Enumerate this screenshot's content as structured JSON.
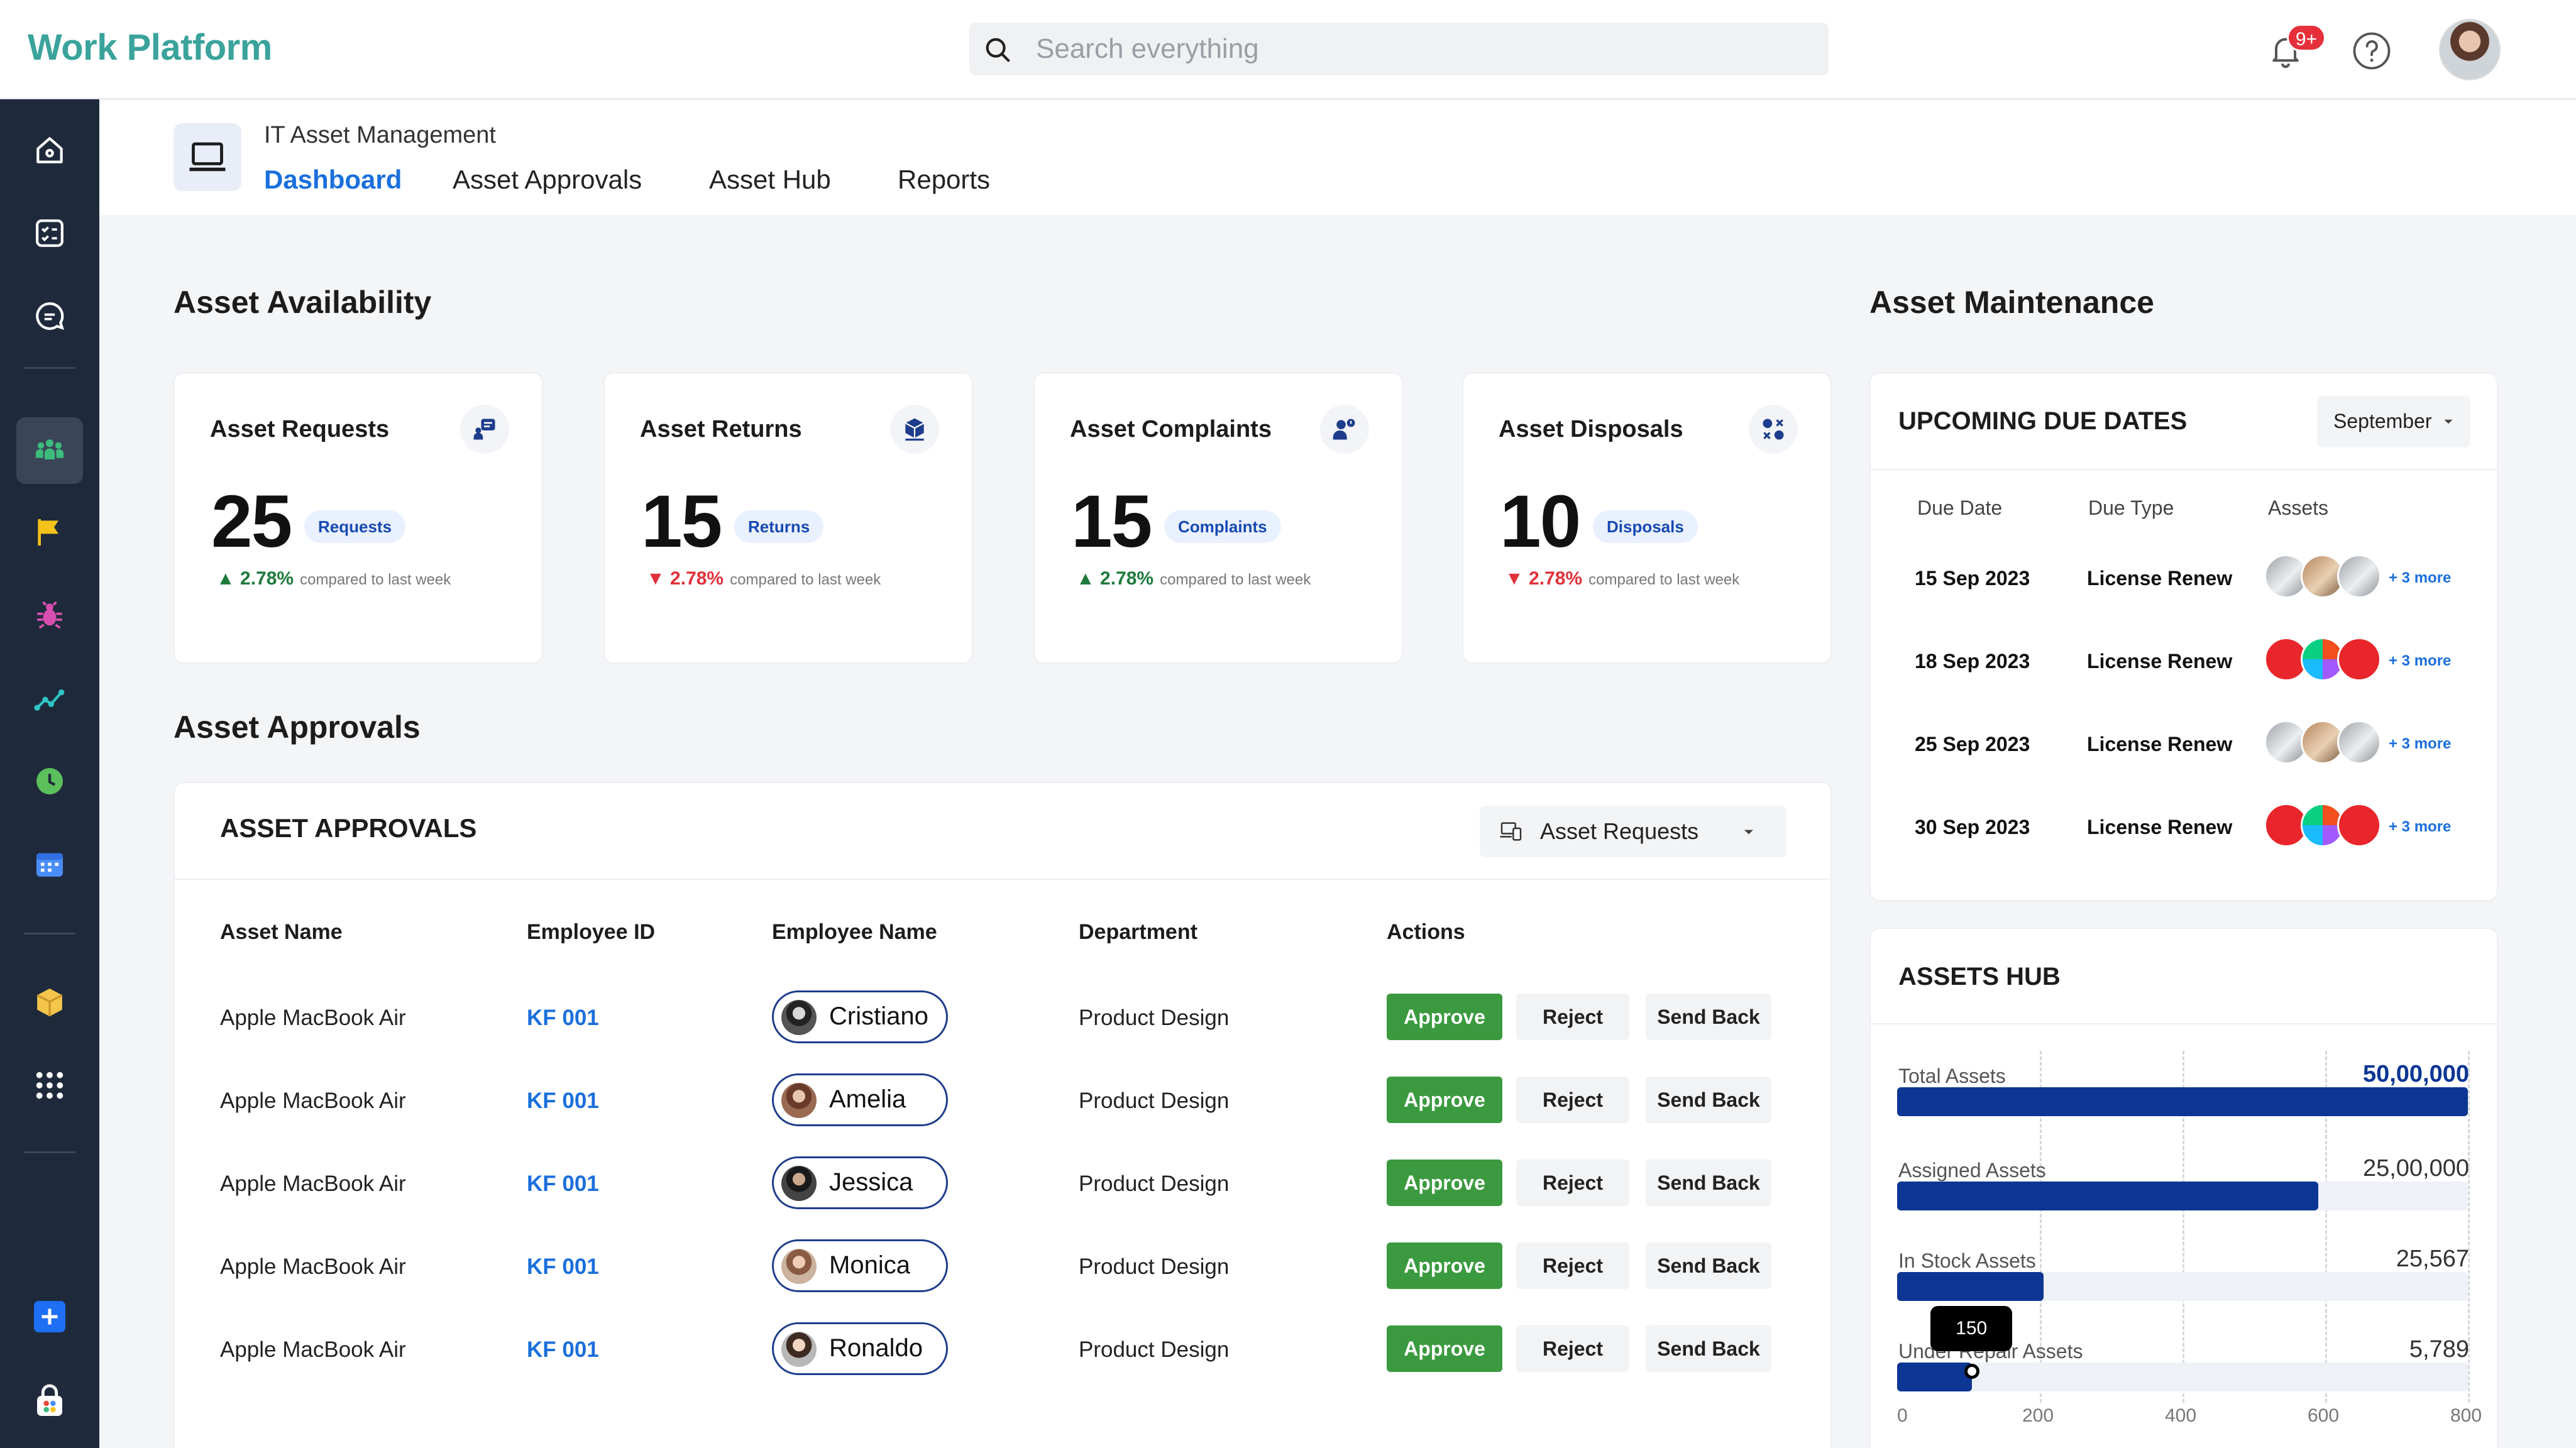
{
  "app": {
    "name": "Work Platform"
  },
  "search": {
    "placeholder": "Search everything"
  },
  "notifications": {
    "badge": "9+"
  },
  "sidebar": {
    "items": [
      "home",
      "tasks",
      "chat",
      "team",
      "flag",
      "bug",
      "analytics",
      "clock",
      "calendar",
      "package",
      "apps"
    ]
  },
  "module": {
    "title": "IT Asset Management"
  },
  "tabs": [
    {
      "label": "Dashboard",
      "active": true
    },
    {
      "label": "Asset Approvals",
      "active": false
    },
    {
      "label": "Asset Hub",
      "active": false
    },
    {
      "label": "Reports",
      "active": false
    }
  ],
  "availability": {
    "title": "Asset  Availability",
    "cards": [
      {
        "title": "Asset Requests",
        "value": "25",
        "pill": "Requests",
        "pct": "2.78%",
        "dir": "up",
        "compare": "compared to last week"
      },
      {
        "title": "Asset Returns",
        "value": "15",
        "pill": "Returns",
        "pct": "2.78%",
        "dir": "down",
        "compare": "compared to last week"
      },
      {
        "title": "Asset Complaints",
        "value": "15",
        "pill": "Complaints",
        "pct": "2.78%",
        "dir": "up",
        "compare": "compared to last week"
      },
      {
        "title": "Asset Disposals",
        "value": "10",
        "pill": "Disposals",
        "pct": "2.78%",
        "dir": "down",
        "compare": "compared to last week"
      }
    ]
  },
  "approvals": {
    "section_title": "Asset  Approvals",
    "card_title": "ASSET APPROVALS",
    "filter": "Asset Requests",
    "columns": [
      "Asset Name",
      "Employee ID",
      "Employee Name",
      "Department",
      "Actions"
    ],
    "rows": [
      {
        "asset": "Apple MacBook Air",
        "id": "KF 001",
        "name": "Cristiano",
        "dept": "Product Design"
      },
      {
        "asset": "Apple MacBook Air",
        "id": "KF 001",
        "name": "Amelia",
        "dept": "Product Design"
      },
      {
        "asset": "Apple MacBook Air",
        "id": "KF 001",
        "name": "Jessica",
        "dept": "Product Design"
      },
      {
        "asset": "Apple MacBook Air",
        "id": "KF 001",
        "name": "Monica",
        "dept": "Product Design"
      },
      {
        "asset": "Apple MacBook Air",
        "id": "KF 001",
        "name": "Ronaldo",
        "dept": "Product Design"
      }
    ],
    "actions": {
      "approve": "Approve",
      "reject": "Reject",
      "send_back": "Send Back"
    }
  },
  "maintenance": {
    "section_title": "Asset  Maintenance",
    "card_title": "UPCOMING DUE DATES",
    "month": "September",
    "columns": [
      "Due Date",
      "Due Type",
      "Assets"
    ],
    "rows": [
      {
        "date": "15 Sep 2023",
        "type": "License Renew",
        "assets": "mac",
        "more": "+ 3 more"
      },
      {
        "date": "18 Sep 2023",
        "type": "License Renew",
        "assets": "adobe",
        "more": "+ 3 more"
      },
      {
        "date": "25 Sep 2023",
        "type": "License Renew",
        "assets": "mac",
        "more": "+ 3 more"
      },
      {
        "date": "30 Sep 2023",
        "type": "License Renew",
        "assets": "adobe",
        "more": "+ 3 more"
      }
    ]
  },
  "hub": {
    "card_title": "ASSETS HUB",
    "bars": [
      {
        "label": "Total Assets",
        "value": "50,00,000",
        "bar": 800,
        "highlight": true
      },
      {
        "label": "Assigned Assets",
        "value": "25,00,000",
        "bar": 590,
        "highlight": false
      },
      {
        "label": "In Stock Assets",
        "value": "25,567",
        "bar": 205,
        "highlight": false
      },
      {
        "label": "Under Repair Assets",
        "value": "5,789",
        "bar": 105,
        "highlight": false
      }
    ],
    "tooltip": "150",
    "axis": [
      "0",
      "200",
      "400",
      "600",
      "800"
    ],
    "axis_max": 800
  },
  "colors": {
    "accent": "#1a6fdc",
    "navy": "#0c3694",
    "sidebar": "#1e2a3b",
    "approve": "#3b9a3f",
    "up": "#1e7a3c",
    "down": "#e0313b",
    "logo": "#3aa39b"
  }
}
